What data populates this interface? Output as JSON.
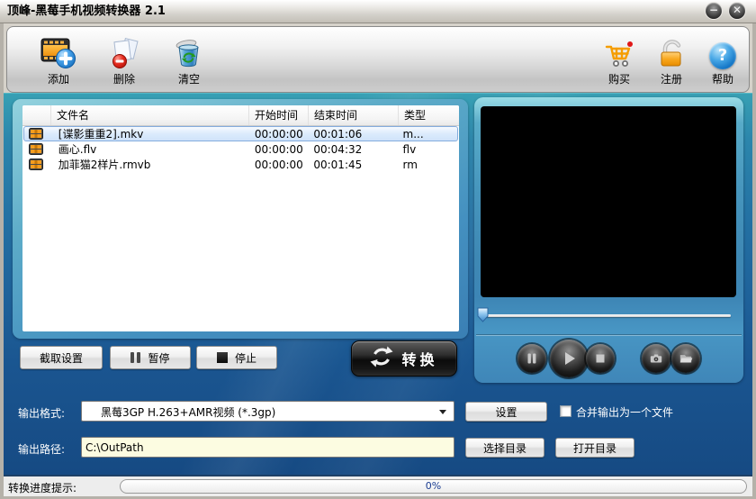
{
  "window": {
    "title": "顶峰-黑莓手机视频转换器 2.1"
  },
  "toolbar": {
    "add": "添加",
    "delete": "删除",
    "clear": "清空",
    "buy": "购买",
    "register": "注册",
    "help": "帮助",
    "help_glyph": "?"
  },
  "file_list": {
    "columns": {
      "name": "文件名",
      "start": "开始时间",
      "end": "结束时间",
      "type": "类型"
    },
    "rows": [
      {
        "name": "[谍影重重2].mkv",
        "start": "00:00:00",
        "end": "00:01:06",
        "type": "m...",
        "selected": true
      },
      {
        "name": "画心.flv",
        "start": "00:00:00",
        "end": "00:04:32",
        "type": "flv",
        "selected": false
      },
      {
        "name": "加菲猫2样片.rmvb",
        "start": "00:00:00",
        "end": "00:01:45",
        "type": "rm",
        "selected": false
      }
    ]
  },
  "actions": {
    "capture_settings": "截取设置",
    "pause": "暂停",
    "stop": "停止",
    "convert": "转换"
  },
  "player": {
    "buttons": [
      "pause-icon",
      "play-icon",
      "stop-icon",
      "snapshot-icon",
      "open-folder-icon"
    ]
  },
  "output": {
    "format_label": "输出格式:",
    "format_value": "黑莓3GP H.263+AMR视频 (*.3gp)",
    "settings_button": "设置",
    "merge_label": "合并输出为一个文件",
    "merge_checked": false,
    "path_label": "输出路径:",
    "path_value": "C:\\OutPath",
    "choose_dir_button": "选择目录",
    "open_dir_button": "打开目录"
  },
  "status": {
    "label": "转换进度提示:",
    "percent_text": "0%",
    "percent": 0
  },
  "colors": {
    "main_bg_top": "#37a0b4",
    "main_bg_bottom": "#164a83",
    "selection_border": "#84acdd",
    "path_input_bg": "#fcfce1",
    "progress_text": "#1a3c91",
    "film_orange": "#f59d20"
  }
}
